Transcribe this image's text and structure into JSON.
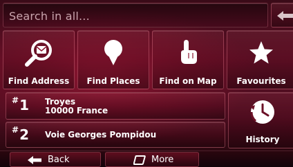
{
  "search": {
    "placeholder": "Search in all..."
  },
  "tiles": [
    {
      "label": "Find Address",
      "icon": "magnifier-address-icon"
    },
    {
      "label": "Find Places",
      "icon": "map-pin-icon"
    },
    {
      "label": "Find on Map",
      "icon": "hand-pointer-icon"
    },
    {
      "label": "Favourites",
      "icon": "star-icon"
    }
  ],
  "history": {
    "items": [
      {
        "hash": "#",
        "number": "1",
        "line1": "Troyes",
        "line2": "10000 France"
      },
      {
        "hash": "#",
        "number": "2",
        "line1": "Voie Georges Pompidou",
        "line2": ""
      }
    ],
    "label": "History",
    "icon": "history-clock-icon"
  },
  "bottom_bar": {
    "back_label": "Back",
    "more_label": "More"
  },
  "colors": {
    "background": "#5a0f24",
    "text": "#ffffff",
    "placeholder": "#c9a5ae"
  }
}
